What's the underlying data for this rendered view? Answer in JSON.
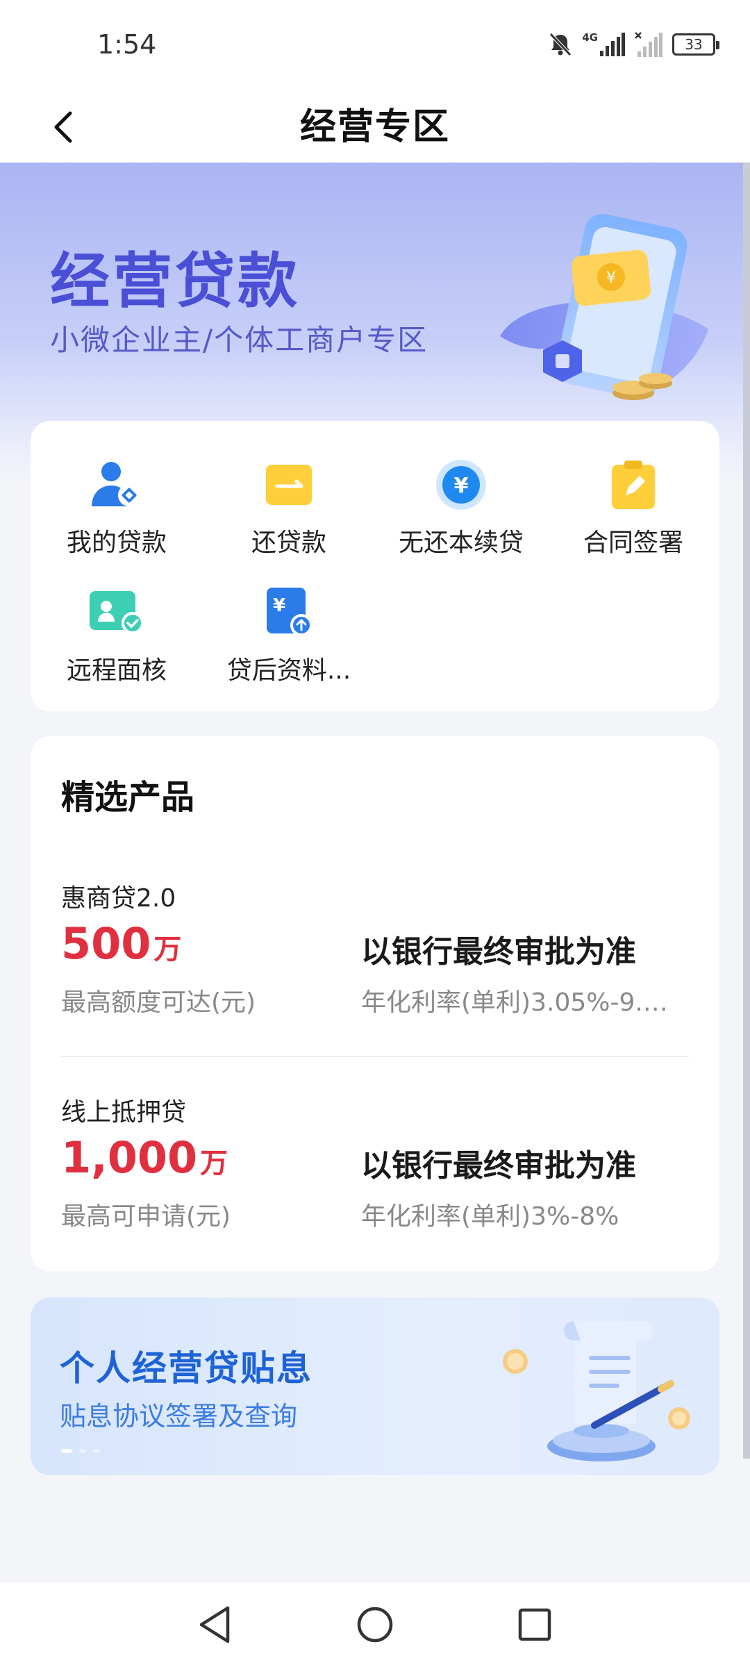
{
  "status_bar": {
    "time": "1:54",
    "network_label": "4G",
    "battery": "33",
    "icons": [
      "bell-muted-icon",
      "signal-4g-icon",
      "signal-no-sim-icon",
      "battery-icon"
    ]
  },
  "nav": {
    "title": "经营专区",
    "back_icon": "chevron-left-icon"
  },
  "hero": {
    "title": "经营贷款",
    "subtitle": "小微企业主/个体工商户专区"
  },
  "actions": [
    {
      "label": "我的贷款",
      "icon": "user-loan-icon"
    },
    {
      "label": "还贷款",
      "icon": "repay-icon"
    },
    {
      "label": "无还本续贷",
      "icon": "renew-loan-icon"
    },
    {
      "label": "合同签署",
      "icon": "contract-sign-icon"
    },
    {
      "label": "远程面核",
      "icon": "remote-verify-icon"
    },
    {
      "label": "贷后资料...",
      "icon": "upload-docs-icon"
    }
  ],
  "products": {
    "title": "精选产品",
    "items": [
      {
        "name": "惠商贷2.0",
        "amount": "500",
        "unit": "万",
        "amount_label": "最高额度可达(元)",
        "approval": "以银行最终审批为准",
        "rate": "年化利率(单利)3.05%-9.…"
      },
      {
        "name": "线上抵押贷",
        "amount": "1,000",
        "unit": "万",
        "amount_label": "最高可申请(元)",
        "approval": "以银行最终审批为准",
        "rate": "年化利率(单利)3%-8%"
      }
    ]
  },
  "banner": {
    "title": "个人经营贷贴息",
    "subtitle": "贴息协议签署及查询"
  },
  "colors": {
    "accent_red": "#e0303f",
    "hero_title": "#4a4fd6",
    "banner_title": "#1e63d6",
    "icon_blue": "#2b7be9",
    "icon_yellow": "#ffce3b",
    "icon_green": "#3ccfb3"
  },
  "system_nav": [
    "back-triangle-icon",
    "home-circle-icon",
    "recents-square-icon"
  ]
}
